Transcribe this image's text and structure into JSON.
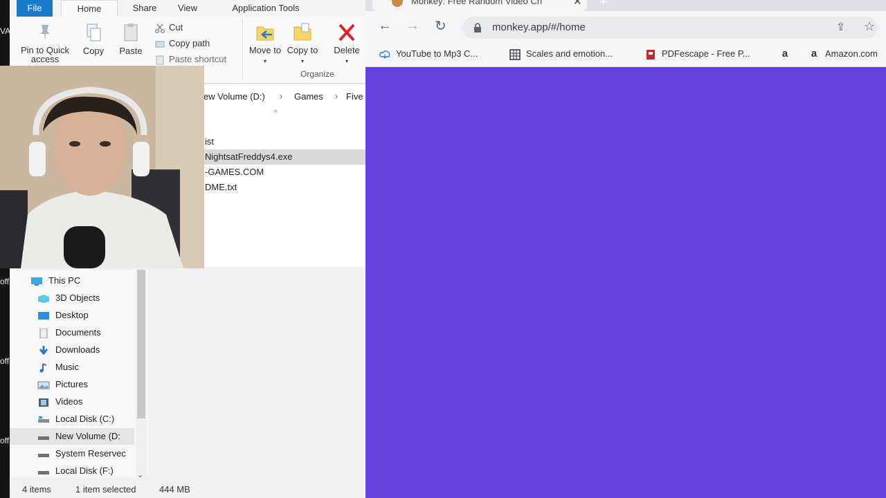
{
  "desktop": {
    "strip_text_1": "VA",
    "strip_text_2": "off",
    "strip_text_3": "off",
    "strip_text_4": "off",
    "strip_text_5": "off"
  },
  "explorer": {
    "tabs": {
      "file": "File",
      "home": "Home",
      "share": "Share",
      "view": "View",
      "app_tools": "Application Tools"
    },
    "ribbon": {
      "pin": "Pin to Quick access",
      "copy": "Copy",
      "paste": "Paste",
      "cut": "Cut",
      "copy_path": "Copy path",
      "paste_shortcut": "Paste shortcut",
      "move_to": "Move to",
      "copy_to": "Copy to",
      "delete": "Delete",
      "group_organize": "Organize"
    },
    "breadcrumb": [
      "ew Volume (D:)",
      "Games",
      "Five"
    ],
    "files": [
      {
        "name": "ist",
        "selected": false
      },
      {
        "name": "NightsatFreddys4.exe",
        "selected": true
      },
      {
        "name": "-GAMES.COM",
        "selected": false
      },
      {
        "name": "DME.txt",
        "selected": false
      }
    ],
    "nav": [
      {
        "label": "This PC",
        "icon": "pc-icon"
      },
      {
        "label": "3D Objects",
        "icon": "cube-icon"
      },
      {
        "label": "Desktop",
        "icon": "desktop-icon"
      },
      {
        "label": "Documents",
        "icon": "document-icon"
      },
      {
        "label": "Downloads",
        "icon": "download-icon"
      },
      {
        "label": "Music",
        "icon": "music-icon"
      },
      {
        "label": "Pictures",
        "icon": "picture-icon"
      },
      {
        "label": "Videos",
        "icon": "video-icon"
      },
      {
        "label": "Local Disk (C:)",
        "icon": "drive-icon"
      },
      {
        "label": "New Volume (D:",
        "icon": "drive-icon"
      },
      {
        "label": "System Reservec",
        "icon": "drive-icon"
      },
      {
        "label": "Local Disk (F:)",
        "icon": "drive-icon"
      }
    ],
    "status": {
      "items": "4 items",
      "selected": "1 item selected",
      "size": "444 MB"
    }
  },
  "browser": {
    "tab_title": "Monkey: Free Random Video Ch",
    "url": "monkey.app/#/home",
    "bookmarks": [
      "YouTube to Mp3 C...",
      "Scales and emotion...",
      "PDFescape - Free P...",
      "Amazon.com"
    ],
    "page_color": "#6741df"
  }
}
